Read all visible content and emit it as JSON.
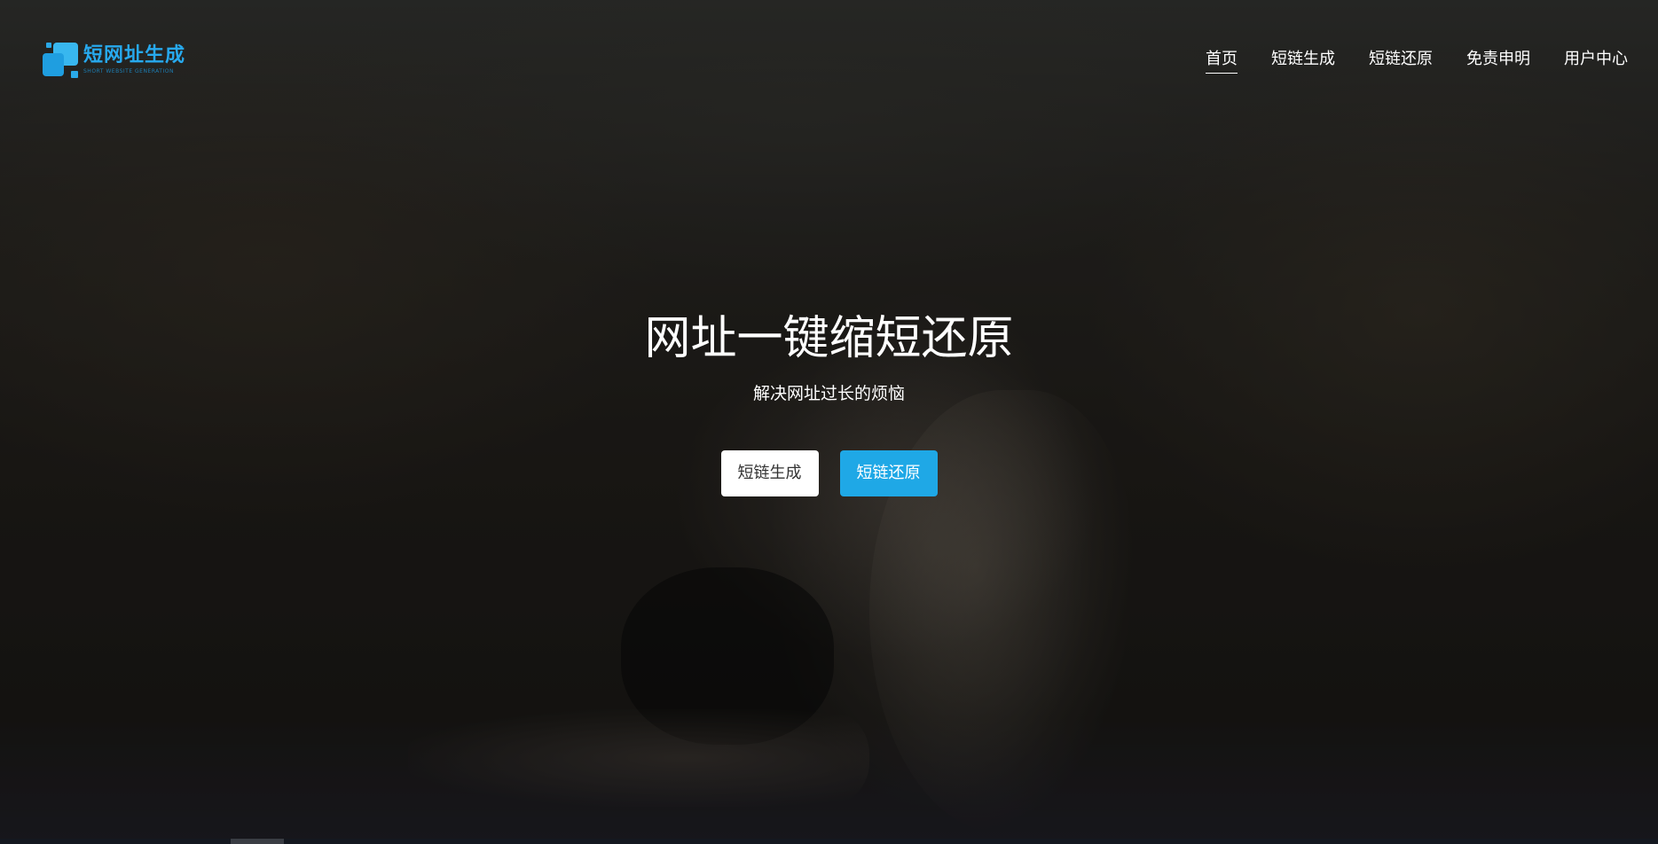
{
  "brand": {
    "name": "短网址生成",
    "subtitle": "SHORT WEBSITE GENERATION",
    "accent_color": "#27a9ee"
  },
  "nav": {
    "items": [
      {
        "label": "首页",
        "active": true
      },
      {
        "label": "短链生成",
        "active": false
      },
      {
        "label": "短链还原",
        "active": false
      },
      {
        "label": "免责申明",
        "active": false
      },
      {
        "label": "用户中心",
        "active": false
      }
    ]
  },
  "hero": {
    "title": "网址一键缩短还原",
    "subtitle": "解决网址过长的烦恼",
    "buttons": {
      "generate_label": "短链生成",
      "restore_label": "短链还原"
    },
    "primary_color": "#1fa8e6"
  }
}
